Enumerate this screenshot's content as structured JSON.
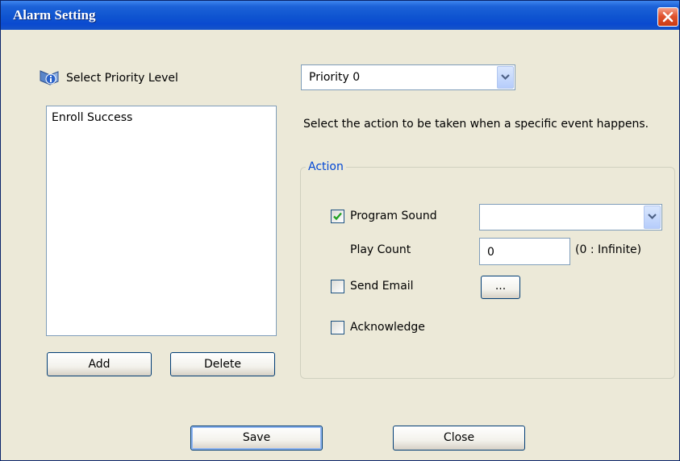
{
  "window": {
    "title": "Alarm Setting"
  },
  "priority": {
    "label": "Select Priority Level",
    "selected": "Priority 0"
  },
  "events": {
    "items": [
      "Enroll Success"
    ]
  },
  "buttons": {
    "add": "Add",
    "delete": "Delete",
    "save": "Save",
    "close": "Close",
    "browse": "..."
  },
  "description": "Select the action to be taken when a specific event happens.",
  "action": {
    "group_label": "Action",
    "program_sound": {
      "label": "Program Sound",
      "checked": true,
      "selected": ""
    },
    "play_count": {
      "label": "Play Count",
      "value": "0",
      "hint": "(0 : Infinite)"
    },
    "send_email": {
      "label": "Send Email",
      "checked": false
    },
    "acknowledge": {
      "label": "Acknowledge",
      "checked": false
    }
  },
  "icons": {
    "close": "close-icon",
    "priority": "priority-icon",
    "dropdown": "chevron-down-icon",
    "check": "checkmark-icon"
  },
  "colors": {
    "titlebar": "#0a4ad0",
    "window_bg": "#ece9d8",
    "group_label": "#0046d5",
    "close_button": "#e0532f"
  }
}
